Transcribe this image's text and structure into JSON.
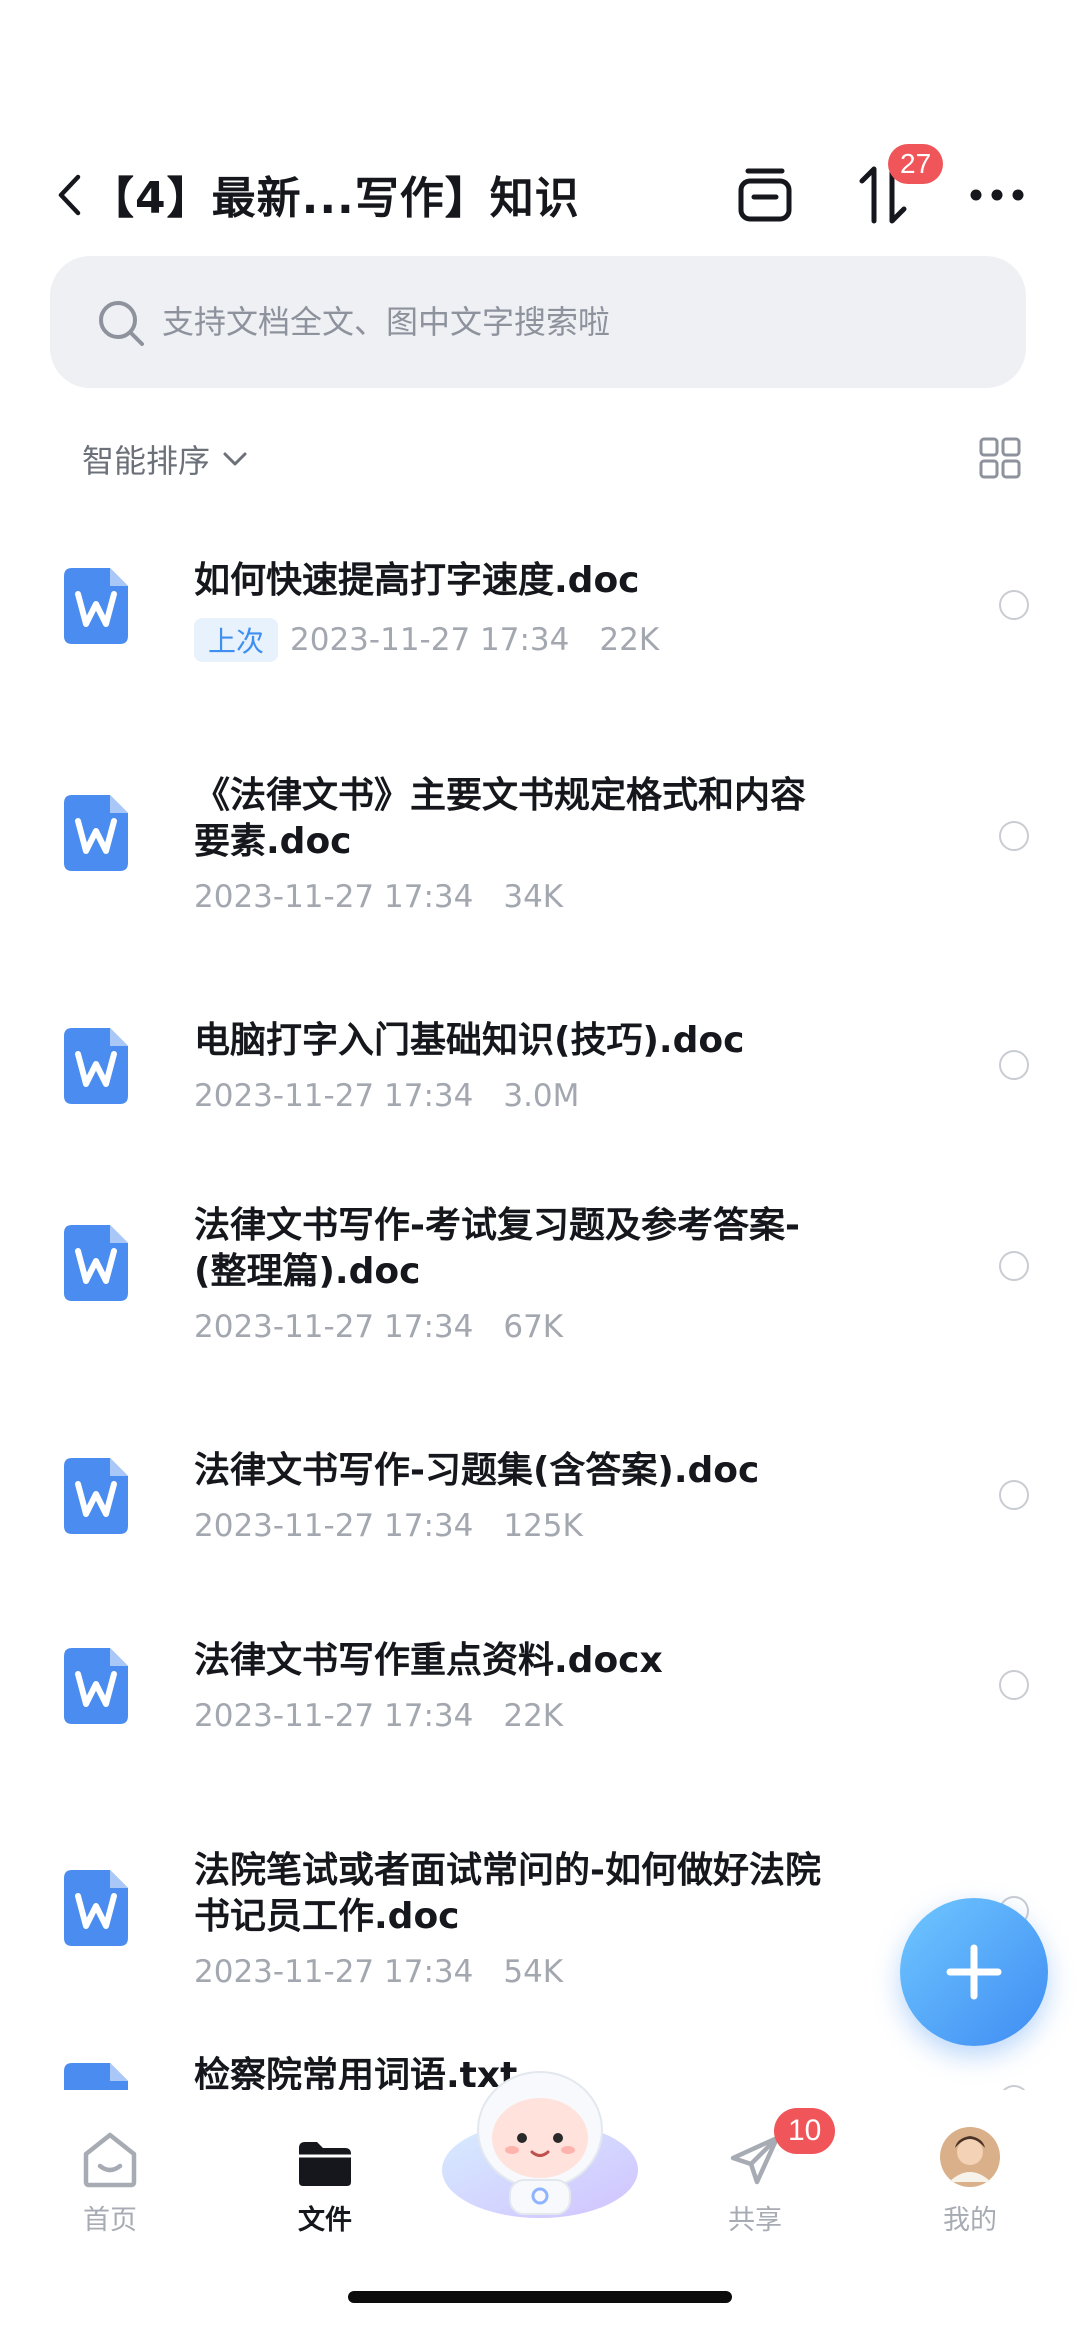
{
  "header": {
    "title": "【4】最新...写作】知识",
    "sort_badge": "27"
  },
  "search": {
    "placeholder": "支持文档全文、图中文字搜索啦"
  },
  "sort": {
    "label": "智能排序"
  },
  "files": [
    {
      "name_lines": [
        "如何快速提高打字速度.doc"
      ],
      "tag": "上次",
      "time": "2023-11-27 17:34",
      "size": "22K",
      "type": "W"
    },
    {
      "name_lines": [
        "《法律文书》主要文书规定格式和内容",
        "要素.doc"
      ],
      "tag": "",
      "time": "2023-11-27 17:34",
      "size": "34K",
      "type": "W"
    },
    {
      "name_lines": [
        "电脑打字入门基础知识(技巧).doc"
      ],
      "tag": "",
      "time": "2023-11-27 17:34",
      "size": "3.0M",
      "type": "W"
    },
    {
      "name_lines": [
        "法律文书写作-考试复习题及参考答案-",
        "(整理篇).doc"
      ],
      "tag": "",
      "time": "2023-11-27 17:34",
      "size": "67K",
      "type": "W"
    },
    {
      "name_lines": [
        "法律文书写作-习题集(含答案).doc"
      ],
      "tag": "",
      "time": "2023-11-27 17:34",
      "size": "125K",
      "type": "W"
    },
    {
      "name_lines": [
        "法律文书写作重点资料.docx"
      ],
      "tag": "",
      "time": "2023-11-27 17:34",
      "size": "22K",
      "type": "W"
    },
    {
      "name_lines": [
        "法院笔试或者面试常问的-如何做好法院",
        "书记员工作.doc"
      ],
      "tag": "",
      "time": "2023-11-27 17:34",
      "size": "54K",
      "type": "W"
    },
    {
      "name_lines": [
        "检察院常用词语.txt"
      ],
      "tag": "",
      "time": "",
      "size": "",
      "type": "T"
    }
  ],
  "tabs": [
    {
      "label": "首页",
      "icon": "home-icon",
      "active": false
    },
    {
      "label": "文件",
      "icon": "folder-icon",
      "active": true
    },
    {
      "label": "共享",
      "icon": "send-icon",
      "active": false,
      "badge": "10"
    },
    {
      "label": "我的",
      "icon": "avatar-icon",
      "active": false
    }
  ],
  "colors": {
    "accent": "#3f8cf3",
    "badge": "#f0555a",
    "doc_icon": "#4a8cf0"
  }
}
